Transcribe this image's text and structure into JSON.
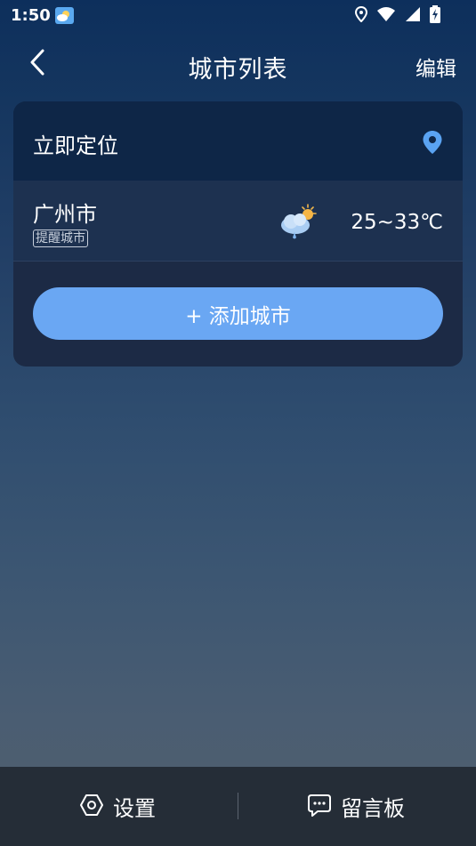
{
  "status_bar": {
    "time": "1:50",
    "icons": [
      "weather-app-icon",
      "location-icon",
      "wifi-icon",
      "signal-icon",
      "battery-charging-icon"
    ]
  },
  "header": {
    "title": "城市列表",
    "edit_label": "编辑",
    "back_icon": "chevron-left-icon"
  },
  "card": {
    "locate_label": "立即定位",
    "locate_icon": "location-pin-icon",
    "cities": [
      {
        "name": "广州市",
        "tag": "提醒城市",
        "weather_icon": "cloud-rain-sun-icon",
        "temp": "25~33℃"
      }
    ],
    "add_label": "+ 添加城市"
  },
  "bottom_bar": {
    "settings_label": "设置",
    "settings_icon": "hexagon-settings-icon",
    "board_label": "留言板",
    "board_icon": "chat-bubble-icon"
  },
  "colors": {
    "accent": "#6aa7f3",
    "locate_pin": "#5aa3f2",
    "card_bg": "#1c2a45",
    "bottom_bar_bg": "#252d37"
  }
}
